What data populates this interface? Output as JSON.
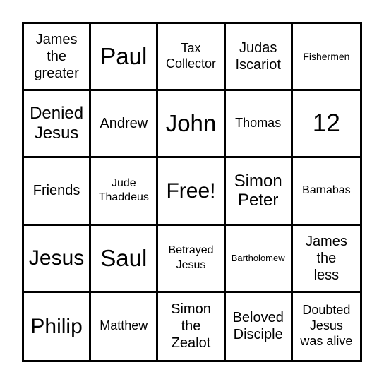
{
  "card": {
    "rows": 5,
    "columns": 5,
    "cells": [
      {
        "text": "James the greater",
        "size": "s-m3",
        "lines": [
          "James",
          "the",
          "greater"
        ]
      },
      {
        "text": "Paul",
        "size": "s-lg",
        "lines": [
          "Paul"
        ]
      },
      {
        "text": "Tax Collector",
        "size": "s-sm",
        "lines": [
          "Tax",
          "Collector"
        ]
      },
      {
        "text": "Judas Iscariot",
        "size": "s-m3",
        "lines": [
          "Judas",
          "Iscariot"
        ]
      },
      {
        "text": "Fishermen",
        "size": "s-xxs",
        "lines": [
          "Fishermen"
        ]
      },
      {
        "text": "Denied Jesus",
        "size": "s-md",
        "lines": [
          "Denied",
          "Jesus"
        ]
      },
      {
        "text": "Andrew",
        "size": "s-m3",
        "lines": [
          "Andrew"
        ]
      },
      {
        "text": "John",
        "size": "s-lg",
        "lines": [
          "John"
        ]
      },
      {
        "text": "Thomas",
        "size": "s-sm",
        "lines": [
          "Thomas"
        ]
      },
      {
        "text": "12",
        "size": "s-xl",
        "lines": [
          "12"
        ]
      },
      {
        "text": "Friends",
        "size": "s-m3",
        "lines": [
          "Friends"
        ]
      },
      {
        "text": "Jude Thaddeus",
        "size": "s-xs",
        "lines": [
          "Jude",
          "Thaddeus"
        ]
      },
      {
        "text": "Free!",
        "size": "s-l2",
        "lines": [
          "Free!"
        ]
      },
      {
        "text": "Simon Peter",
        "size": "s-md",
        "lines": [
          "Simon",
          "Peter"
        ]
      },
      {
        "text": "Barnabas",
        "size": "s-xs",
        "lines": [
          "Barnabas"
        ]
      },
      {
        "text": "Jesus",
        "size": "s-l2",
        "lines": [
          "Jesus"
        ]
      },
      {
        "text": "Saul",
        "size": "s-lg",
        "lines": [
          "Saul"
        ]
      },
      {
        "text": "Betrayed Jesus",
        "size": "s-xs",
        "lines": [
          "Betrayed",
          "Jesus"
        ]
      },
      {
        "text": "Bartholomew",
        "size": "s-tiny",
        "lines": [
          "Bartholomew"
        ]
      },
      {
        "text": "James the less",
        "size": "s-m3",
        "lines": [
          "James",
          "the",
          "less"
        ]
      },
      {
        "text": "Philip",
        "size": "s-l2",
        "lines": [
          "Philip"
        ]
      },
      {
        "text": "Matthew",
        "size": "s-sm",
        "lines": [
          "Matthew"
        ]
      },
      {
        "text": "Simon the Zealot",
        "size": "s-m3",
        "lines": [
          "Simon",
          "the",
          "Zealot"
        ]
      },
      {
        "text": "Beloved Disciple",
        "size": "s-m3",
        "lines": [
          "Beloved",
          "Disciple"
        ]
      },
      {
        "text": "Doubted Jesus was alive",
        "size": "s-sm",
        "lines": [
          "Doubted",
          "Jesus",
          "was alive"
        ]
      }
    ]
  }
}
